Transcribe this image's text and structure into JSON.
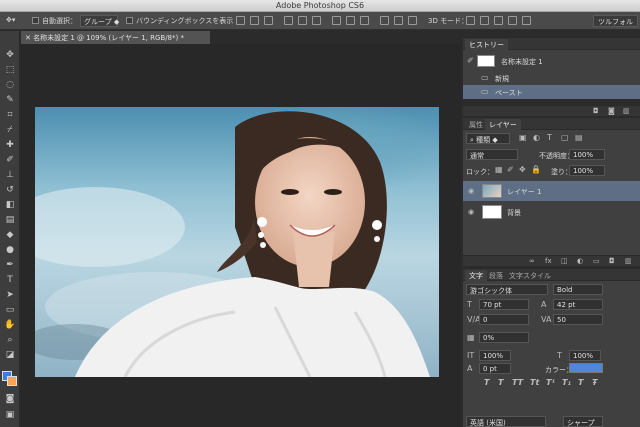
{
  "window": {
    "title": "Adobe Photoshop CS6"
  },
  "options_bar": {
    "auto_select_label": "自動選択：",
    "auto_select_value": "グループ",
    "bounding_box_label": "バウンディングボックスを表示",
    "mode_3d_label": "3D モード：",
    "workspace_label": "ツルフォル"
  },
  "document": {
    "tab_label": "名称未設定 1 @ 109% (レイヤー 1, RGB/8*) *"
  },
  "history": {
    "tab": "ヒストリー",
    "snapshot": "名称未設定 1",
    "items": [
      {
        "label": "新規"
      },
      {
        "label": "ペースト"
      }
    ]
  },
  "layers": {
    "tab_properties": "属性",
    "tab_layers": "レイヤー",
    "filter_kind": "種類",
    "blend_mode": "通常",
    "opacity_label": "不透明度：",
    "opacity_value": "100%",
    "lock_label": "ロック：",
    "fill_label": "塗り：",
    "fill_value": "100%",
    "items": [
      {
        "label": "レイヤー 1"
      },
      {
        "label": "背景"
      }
    ]
  },
  "character": {
    "tab_text": "文字",
    "tab_paragraph": "段落",
    "tab_styles": "文字スタイル",
    "font_family": "游ゴシック体",
    "font_style": "Bold",
    "font_size": "70 pt",
    "leading": "42 pt",
    "kerning": "0",
    "tracking": "50",
    "tsume": "0%",
    "vertical_scale": "100%",
    "horizontal_scale": "100%",
    "baseline_shift": "0 pt",
    "color_label": "カラー：",
    "language": "英語 (米国)",
    "antialias": "シャープ",
    "text_color": "#4f86d9"
  },
  "colors": {
    "foreground": "#3d7de0",
    "background": "#f4a460"
  }
}
